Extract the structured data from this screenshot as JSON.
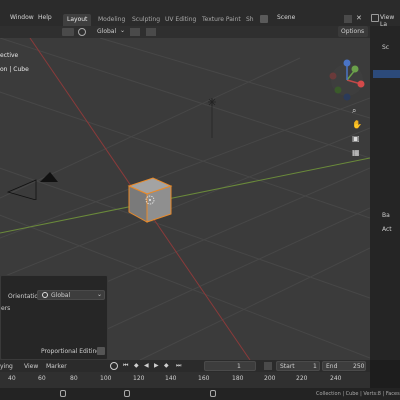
{
  "menubar": {
    "window_label": "Window",
    "help_label": "Help",
    "tabs": [
      "Layout",
      "Modeling",
      "Sculpting",
      "UV Editing",
      "Texture Paint",
      "Sh"
    ],
    "scene_label": "Scene",
    "view_layer_label": "View La"
  },
  "viewport_header": {
    "view": "View",
    "select": "Select",
    "add": "Add",
    "object": "Object",
    "orientation": "Global",
    "options": "Options"
  },
  "viewport_info": {
    "line1": "ective",
    "line2": "on | Cube"
  },
  "operator_panel": {
    "orientation_label": "Orientation",
    "orientation_value": "Global",
    "truncated_label": "ers",
    "proportional_editing": "Proportional Editing"
  },
  "timeline": {
    "playback": "ying",
    "view": "View",
    "marker": "Marker",
    "current_frame": "1",
    "start_label": "Start",
    "start_value": "1",
    "end_label": "End",
    "end_value": "250",
    "ruler": [
      "40",
      "60",
      "80",
      "100",
      "120",
      "140",
      "160",
      "180",
      "200",
      "220",
      "240"
    ]
  },
  "status": {
    "info": "Collection | Cube | Verts:8 | Faces"
  },
  "outliner": {
    "letters": [
      "Sc",
      "Ba",
      "Act"
    ]
  }
}
